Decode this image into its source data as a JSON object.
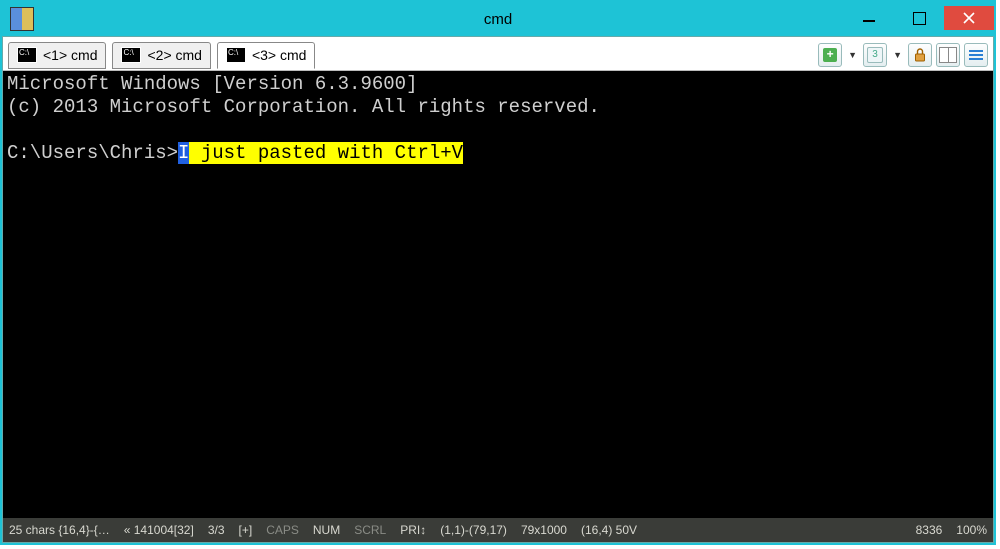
{
  "window": {
    "title": "cmd"
  },
  "tabs": [
    {
      "label": "<1> cmd"
    },
    {
      "label": "<2> cmd"
    },
    {
      "label": "<3> cmd"
    }
  ],
  "active_tab_index": 2,
  "toolbar": {
    "badge_number": "3"
  },
  "console": {
    "line1": "Microsoft Windows [Version 6.3.9600]",
    "line2": "(c) 2013 Microsoft Corporation. All rights reserved.",
    "prompt": "C:\\Users\\Chris>",
    "pasted_first_char": "I",
    "pasted_rest": " just pasted with Ctrl+V"
  },
  "status": {
    "chars": "25 chars {16,4}-{…",
    "encoded": "« 141004[32]",
    "page": "3/3",
    "plus": "[+]",
    "caps": "CAPS",
    "num": "NUM",
    "scrl": "SCRL",
    "pri": "PRI↕",
    "range": "(1,1)-(79,17)",
    "dims": "79x1000",
    "cursor": "(16,4) 50V",
    "pid": "8336",
    "zoom": "100%"
  }
}
